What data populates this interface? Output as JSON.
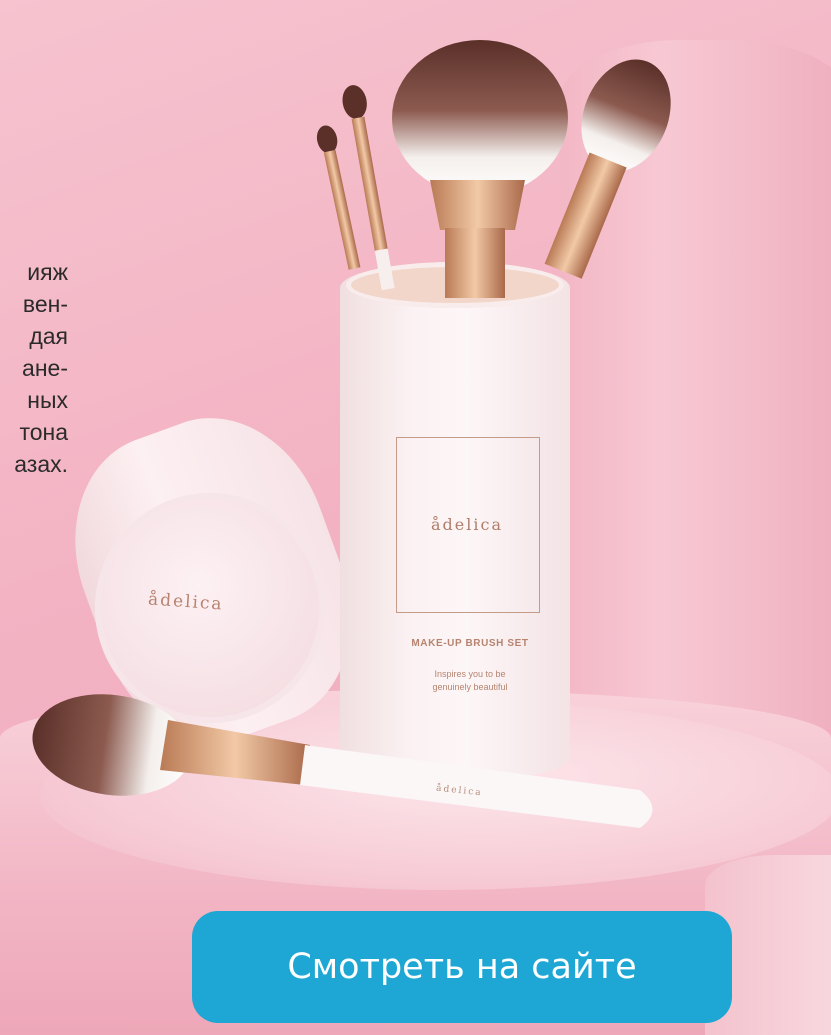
{
  "description": {
    "lines": [
      "ияж",
      "вен-",
      "дая",
      "ане-",
      "ных",
      "тона",
      "азах."
    ]
  },
  "product": {
    "brand": "ådelica",
    "kit_title": "MAKE-UP BRUSH SET",
    "tagline_line1": "Inspires you to be",
    "tagline_line2": "genuinely beautiful",
    "brush_brand": "ådelica"
  },
  "cta": {
    "label": "Смотреть на сайте",
    "color": "#1ea7d4"
  },
  "colors": {
    "background": "#f3b3c3",
    "rose_gold": "#c9936f"
  }
}
